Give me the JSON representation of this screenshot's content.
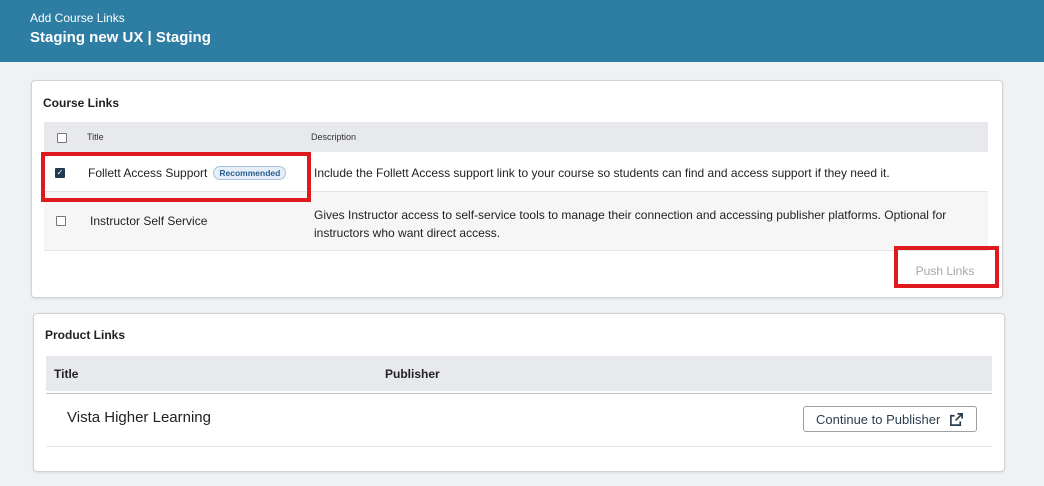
{
  "header": {
    "subtitle": "Add Course Links",
    "title": "Staging new UX | Staging"
  },
  "course_links": {
    "title": "Course Links",
    "columns": [
      "Title",
      "Description"
    ],
    "rows": [
      {
        "checked": true,
        "title": "Follett Access Support",
        "badge": "Recommended",
        "description": "Include the Follett Access support link to your course so students can find and access support if they need it."
      },
      {
        "checked": false,
        "title": "Instructor Self Service",
        "description_line1": "Gives Instructor access to self-service tools to manage their connection and accessing publisher platforms. Optional for",
        "description_line2": "instructors who want direct access."
      }
    ],
    "push_label": "Push Links"
  },
  "product_links": {
    "title": "Product Links",
    "columns": [
      "Title",
      "Publisher"
    ],
    "rows": [
      {
        "title": "Vista Higher Learning",
        "action_label": "Continue to Publisher",
        "action_icon": "external-link-icon"
      }
    ]
  },
  "colors": {
    "header_bg": "#2e7da3",
    "highlight": "#e0191f",
    "badge_text": "#2a5e8f"
  }
}
